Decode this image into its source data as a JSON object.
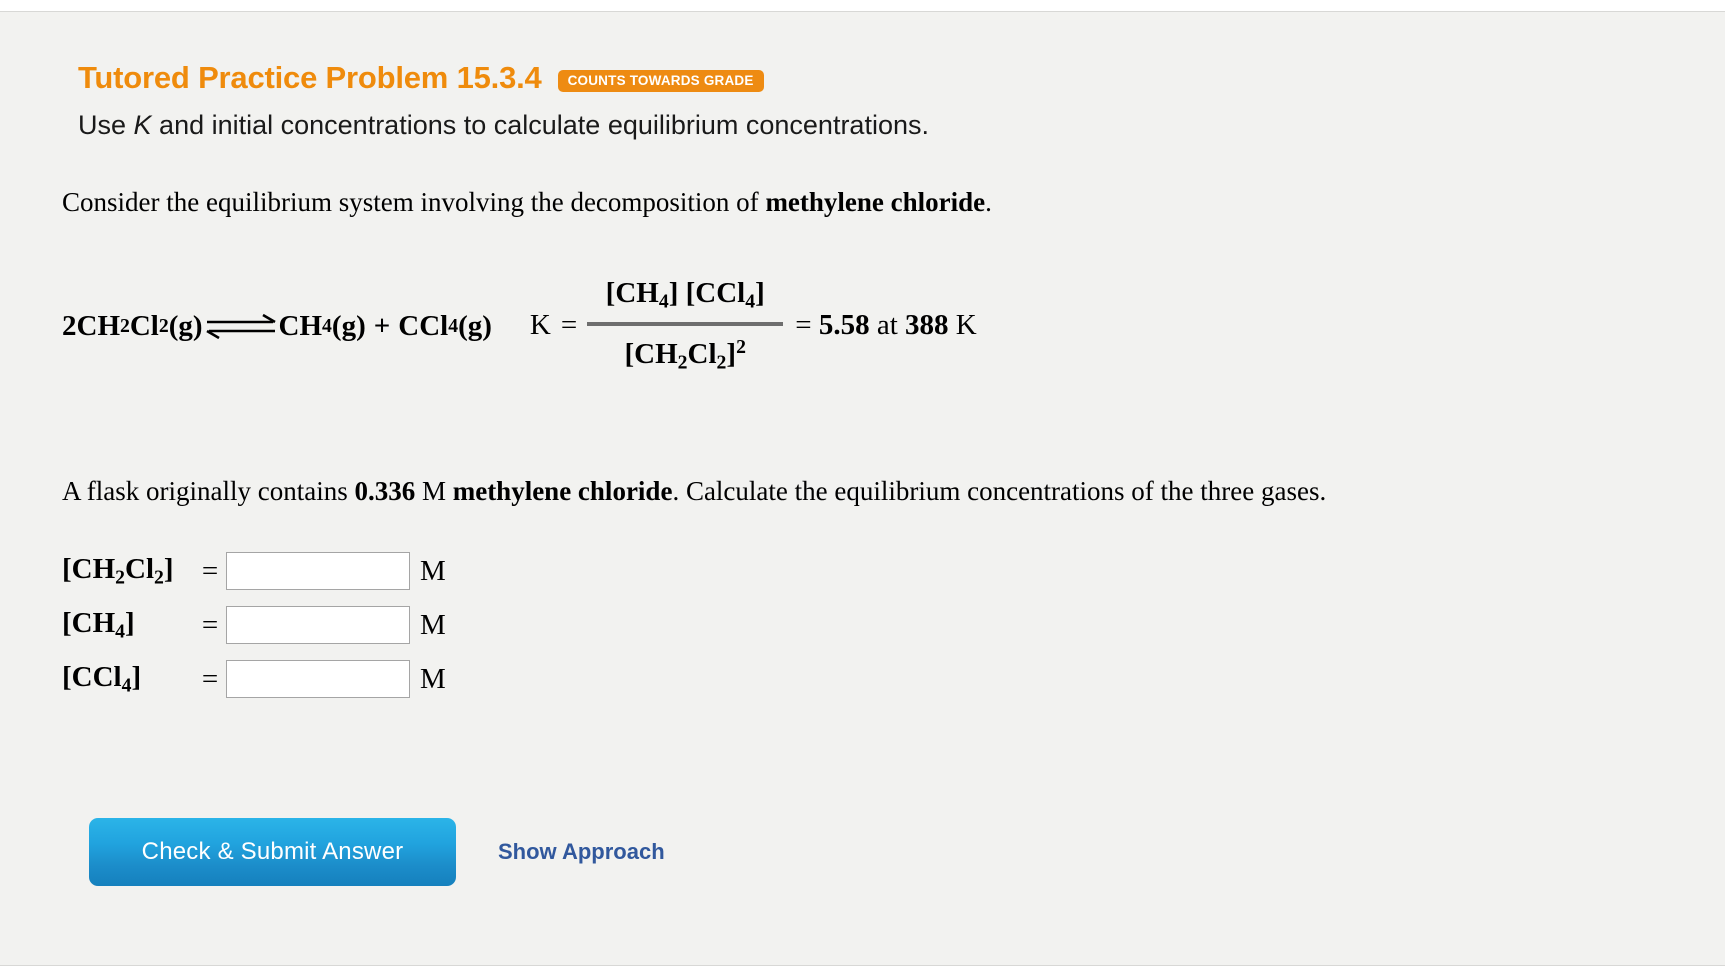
{
  "header": {
    "title": "Tutored Practice Problem 15.3.4",
    "badge": "COUNTS TOWARDS GRADE",
    "subtitle_pre": "Use ",
    "subtitle_italic": "K",
    "subtitle_post": " and initial concentrations to calculate equilibrium concentrations.",
    "title_color": "#ef8b0c",
    "badge_bg": "#ee8b12"
  },
  "problem": {
    "intro_pre": "Consider the equilibrium system involving the decomposition of ",
    "intro_substance": "methylene chloride",
    "intro_post": ".",
    "flask_pre": "A flask originally contains ",
    "flask_concentration": "0.336",
    "flask_mid": " M ",
    "flask_substance": "methylene chloride",
    "flask_post": ". Calculate the equilibrium concentrations of the three gases."
  },
  "equation": {
    "reactant_coefficient": "2",
    "reactant_formula": "CH",
    "reactant_sub1": "2",
    "reactant_formula2": "Cl",
    "reactant_sub2": "2",
    "reactant_state": "(g)",
    "arrow": "equilibrium-double-harpoon",
    "product1_formula": "CH",
    "product1_sub": "4",
    "product1_state": "(g)",
    "plus": "+",
    "product2_formula": "CCl",
    "product2_sub": "4",
    "product2_state": "(g)",
    "k_letter": "K",
    "k_equals": "=",
    "numerator": "[CH4] [CCl4]",
    "numerator_parts": {
      "a_open": "[CH",
      "a_sub": "4",
      "a_close": "] ",
      "b_open": "[CCl",
      "b_sub": "4",
      "b_close": "]"
    },
    "denominator_parts": {
      "open": "[CH",
      "sub1": "2",
      "mid": "Cl",
      "sub2": "2",
      "close": "]",
      "power": "2"
    },
    "result_equals": "=",
    "k_value": "5.58",
    "at_word": "at",
    "temperature": "388",
    "temperature_unit": "K",
    "bar_color": "#6e6e6e"
  },
  "answers": {
    "unit": "M",
    "equals": "=",
    "rows": [
      {
        "label_parts": {
          "open": "[CH",
          "sub1": "2",
          "mid": "Cl",
          "sub2": "2",
          "close": "]"
        },
        "value": "",
        "placeholder": ""
      },
      {
        "label_parts": {
          "open": "[CH",
          "sub1": "4",
          "mid": "",
          "sub2": "",
          "close": "]"
        },
        "value": "",
        "placeholder": ""
      },
      {
        "label_parts": {
          "open": "[CCl",
          "sub1": "4",
          "mid": "",
          "sub2": "",
          "close": "]"
        },
        "value": "",
        "placeholder": ""
      }
    ]
  },
  "actions": {
    "submit_label": "Check & Submit Answer",
    "show_approach_label": "Show Approach",
    "submit_color": "#1f9fdb",
    "link_color": "#31589d"
  }
}
